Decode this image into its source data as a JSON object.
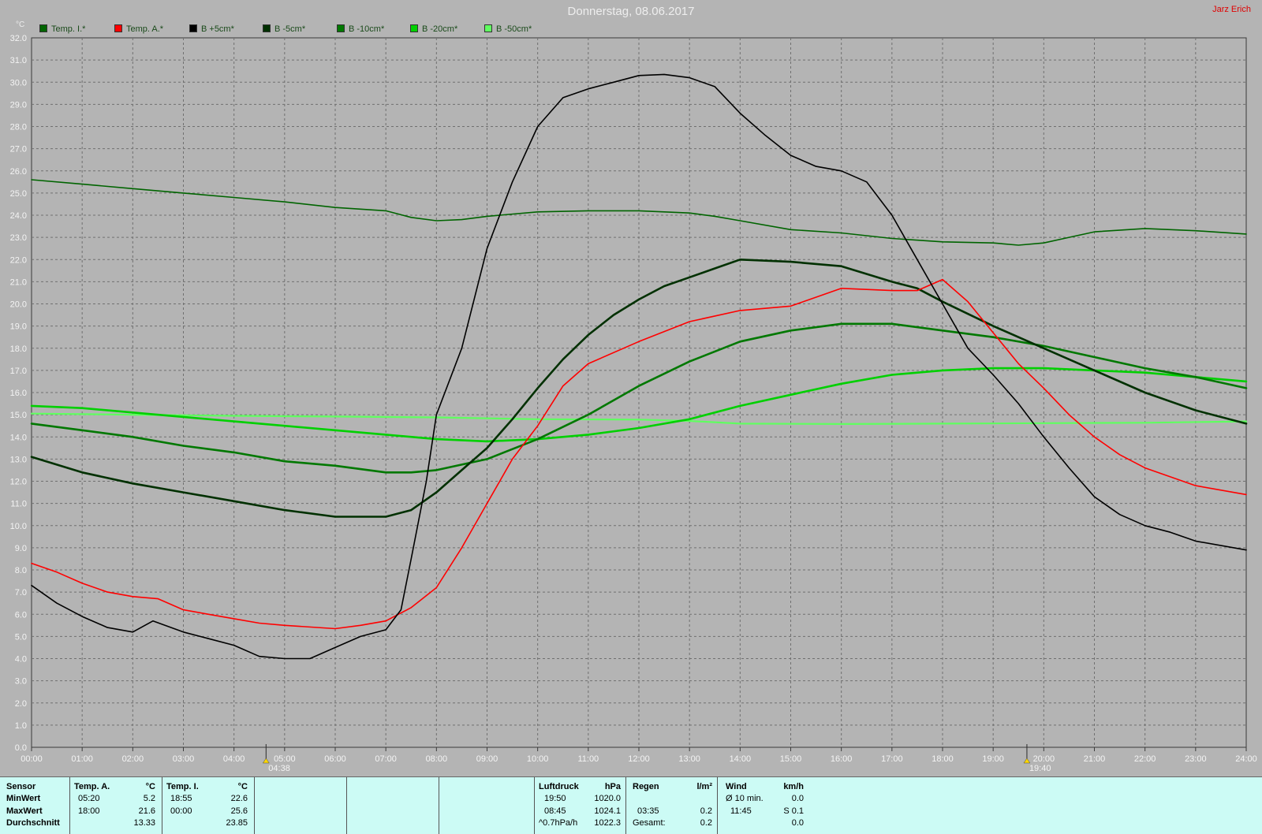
{
  "header": {
    "title": "Donnerstag, 08.06.2017",
    "author": "Jarz Erich",
    "unit": "°C"
  },
  "legend": [
    {
      "label": "Temp. I.*",
      "color": "#006400"
    },
    {
      "label": "Temp. A.*",
      "color": "#ff0000"
    },
    {
      "label": "B +5cm*",
      "color": "#000000"
    },
    {
      "label": "B -5cm*",
      "color": "#003000"
    },
    {
      "label": "B -10cm*",
      "color": "#007800"
    },
    {
      "label": "B -20cm*",
      "color": "#00d000"
    },
    {
      "label": "B -50cm*",
      "color": "#60ff60"
    }
  ],
  "sun_markers": {
    "sunrise": "04:38",
    "sunset": "19:40"
  },
  "chart_data": {
    "type": "line",
    "title": "Donnerstag, 08.06.2017",
    "ylabel": "°C",
    "xlabel": "",
    "xlim": [
      0,
      24
    ],
    "ylim": [
      0,
      32
    ],
    "grid": true,
    "legend_position": "top-left",
    "x_tick_labels": [
      "00:00",
      "01:00",
      "02:00",
      "03:00",
      "04:00",
      "05:00",
      "06:00",
      "07:00",
      "08:00",
      "09:00",
      "10:00",
      "11:00",
      "12:00",
      "13:00",
      "14:00",
      "15:00",
      "16:00",
      "17:00",
      "18:00",
      "19:00",
      "20:00",
      "21:00",
      "22:00",
      "23:00",
      "24:00"
    ],
    "y_tick_labels": [
      "0.0",
      "1.0",
      "2.0",
      "3.0",
      "4.0",
      "5.0",
      "6.0",
      "7.0",
      "8.0",
      "9.0",
      "10.0",
      "11.0",
      "12.0",
      "13.0",
      "14.0",
      "15.0",
      "16.0",
      "17.0",
      "18.0",
      "19.0",
      "20.0",
      "21.0",
      "22.0",
      "23.0",
      "24.0",
      "25.0",
      "26.0",
      "27.0",
      "28.0",
      "29.0",
      "30.0",
      "31.0",
      "32.0"
    ],
    "series": [
      {
        "name": "Temp. I.*",
        "color": "#006400",
        "width": 1.6,
        "points": [
          [
            0,
            25.6
          ],
          [
            1,
            25.4
          ],
          [
            2,
            25.2
          ],
          [
            3,
            25.0
          ],
          [
            4,
            24.8
          ],
          [
            5,
            24.6
          ],
          [
            6,
            24.35
          ],
          [
            7,
            24.2
          ],
          [
            7.5,
            23.9
          ],
          [
            8,
            23.75
          ],
          [
            8.5,
            23.8
          ],
          [
            9,
            23.95
          ],
          [
            10,
            24.15
          ],
          [
            11,
            24.2
          ],
          [
            12,
            24.2
          ],
          [
            13,
            24.1
          ],
          [
            13.5,
            23.95
          ],
          [
            14,
            23.75
          ],
          [
            15,
            23.35
          ],
          [
            16,
            23.2
          ],
          [
            17,
            22.95
          ],
          [
            18,
            22.8
          ],
          [
            19,
            22.75
          ],
          [
            19.5,
            22.65
          ],
          [
            20,
            22.75
          ],
          [
            20.5,
            23.0
          ],
          [
            21,
            23.25
          ],
          [
            22,
            23.4
          ],
          [
            23,
            23.3
          ],
          [
            24,
            23.15
          ]
        ]
      },
      {
        "name": "Temp. A.*",
        "color": "#ff0000",
        "width": 1.6,
        "points": [
          [
            0,
            8.3
          ],
          [
            0.5,
            7.9
          ],
          [
            1,
            7.4
          ],
          [
            1.5,
            7.0
          ],
          [
            2,
            6.8
          ],
          [
            2.5,
            6.7
          ],
          [
            3,
            6.2
          ],
          [
            3.5,
            6.0
          ],
          [
            4,
            5.8
          ],
          [
            4.5,
            5.6
          ],
          [
            5,
            5.5
          ],
          [
            6,
            5.35
          ],
          [
            6.5,
            5.5
          ],
          [
            7,
            5.7
          ],
          [
            7.5,
            6.3
          ],
          [
            8,
            7.2
          ],
          [
            8.5,
            9.0
          ],
          [
            9,
            11.0
          ],
          [
            9.5,
            13.0
          ],
          [
            10,
            14.5
          ],
          [
            10.5,
            16.3
          ],
          [
            11,
            17.3
          ],
          [
            12,
            18.3
          ],
          [
            13,
            19.2
          ],
          [
            14,
            19.7
          ],
          [
            15,
            19.9
          ],
          [
            16,
            20.7
          ],
          [
            17,
            20.6
          ],
          [
            17.5,
            20.6
          ],
          [
            18,
            21.1
          ],
          [
            18.5,
            20.1
          ],
          [
            19,
            18.7
          ],
          [
            19.5,
            17.3
          ],
          [
            20,
            16.2
          ],
          [
            20.5,
            15.0
          ],
          [
            21,
            14.0
          ],
          [
            21.5,
            13.2
          ],
          [
            22,
            12.6
          ],
          [
            22.5,
            12.2
          ],
          [
            23,
            11.8
          ],
          [
            24,
            11.4
          ]
        ]
      },
      {
        "name": "B +5cm*",
        "color": "#000000",
        "width": 1.6,
        "points": [
          [
            0,
            7.3
          ],
          [
            0.5,
            6.5
          ],
          [
            1,
            5.9
          ],
          [
            1.5,
            5.4
          ],
          [
            2,
            5.2
          ],
          [
            2.4,
            5.7
          ],
          [
            3,
            5.2
          ],
          [
            3.5,
            4.9
          ],
          [
            4,
            4.6
          ],
          [
            4.5,
            4.1
          ],
          [
            5,
            4.0
          ],
          [
            5.5,
            4.0
          ],
          [
            6,
            4.5
          ],
          [
            6.5,
            5.0
          ],
          [
            7,
            5.3
          ],
          [
            7.3,
            6.2
          ],
          [
            7.5,
            8.5
          ],
          [
            7.8,
            12.0
          ],
          [
            8,
            15.0
          ],
          [
            8.5,
            18.0
          ],
          [
            9,
            22.5
          ],
          [
            9.5,
            25.5
          ],
          [
            10,
            28.0
          ],
          [
            10.5,
            29.3
          ],
          [
            11,
            29.7
          ],
          [
            11.5,
            30.0
          ],
          [
            12,
            30.3
          ],
          [
            12.5,
            30.35
          ],
          [
            13,
            30.2
          ],
          [
            13.5,
            29.8
          ],
          [
            14,
            28.6
          ],
          [
            14.5,
            27.6
          ],
          [
            15,
            26.7
          ],
          [
            15.5,
            26.2
          ],
          [
            16,
            26.0
          ],
          [
            16.5,
            25.5
          ],
          [
            17,
            24.0
          ],
          [
            17.5,
            22.0
          ],
          [
            18,
            20.0
          ],
          [
            18.5,
            18.0
          ],
          [
            19,
            16.8
          ],
          [
            19.5,
            15.5
          ],
          [
            20,
            14.0
          ],
          [
            20.5,
            12.6
          ],
          [
            21,
            11.3
          ],
          [
            21.5,
            10.5
          ],
          [
            22,
            10.0
          ],
          [
            22.5,
            9.7
          ],
          [
            23,
            9.3
          ],
          [
            24,
            8.9
          ]
        ]
      },
      {
        "name": "B -5cm*",
        "color": "#003000",
        "width": 2.6,
        "points": [
          [
            0,
            13.1
          ],
          [
            1,
            12.4
          ],
          [
            2,
            11.9
          ],
          [
            3,
            11.5
          ],
          [
            4,
            11.1
          ],
          [
            5,
            10.7
          ],
          [
            6,
            10.4
          ],
          [
            7,
            10.4
          ],
          [
            7.5,
            10.7
          ],
          [
            8,
            11.5
          ],
          [
            8.5,
            12.5
          ],
          [
            9,
            13.5
          ],
          [
            9.5,
            14.8
          ],
          [
            10,
            16.2
          ],
          [
            10.5,
            17.5
          ],
          [
            11,
            18.6
          ],
          [
            11.5,
            19.5
          ],
          [
            12,
            20.2
          ],
          [
            12.5,
            20.8
          ],
          [
            13,
            21.2
          ],
          [
            13.5,
            21.6
          ],
          [
            14,
            22.0
          ],
          [
            15,
            21.9
          ],
          [
            16,
            21.7
          ],
          [
            17,
            21.0
          ],
          [
            17.5,
            20.7
          ],
          [
            18,
            20.1
          ],
          [
            19,
            19.0
          ],
          [
            20,
            18.0
          ],
          [
            21,
            17.0
          ],
          [
            22,
            16.0
          ],
          [
            23,
            15.2
          ],
          [
            24,
            14.6
          ]
        ]
      },
      {
        "name": "B -10cm*",
        "color": "#007800",
        "width": 2.6,
        "points": [
          [
            0,
            14.6
          ],
          [
            1,
            14.3
          ],
          [
            2,
            14.0
          ],
          [
            3,
            13.6
          ],
          [
            4,
            13.3
          ],
          [
            5,
            12.9
          ],
          [
            6,
            12.7
          ],
          [
            7,
            12.4
          ],
          [
            7.5,
            12.4
          ],
          [
            8,
            12.5
          ],
          [
            9,
            13.0
          ],
          [
            10,
            13.9
          ],
          [
            11,
            15.0
          ],
          [
            12,
            16.3
          ],
          [
            13,
            17.4
          ],
          [
            14,
            18.3
          ],
          [
            15,
            18.8
          ],
          [
            16,
            19.1
          ],
          [
            17,
            19.1
          ],
          [
            18,
            18.8
          ],
          [
            19,
            18.5
          ],
          [
            20,
            18.1
          ],
          [
            21,
            17.6
          ],
          [
            22,
            17.1
          ],
          [
            23,
            16.7
          ],
          [
            24,
            16.2
          ]
        ]
      },
      {
        "name": "B -20cm*",
        "color": "#00d000",
        "width": 2.6,
        "points": [
          [
            0,
            15.4
          ],
          [
            1,
            15.3
          ],
          [
            2,
            15.1
          ],
          [
            3,
            14.9
          ],
          [
            4,
            14.7
          ],
          [
            5,
            14.5
          ],
          [
            6,
            14.3
          ],
          [
            7,
            14.1
          ],
          [
            8,
            13.9
          ],
          [
            9,
            13.8
          ],
          [
            10,
            13.9
          ],
          [
            11,
            14.1
          ],
          [
            12,
            14.4
          ],
          [
            13,
            14.8
          ],
          [
            14,
            15.4
          ],
          [
            15,
            15.9
          ],
          [
            16,
            16.4
          ],
          [
            17,
            16.8
          ],
          [
            18,
            17.0
          ],
          [
            19,
            17.1
          ],
          [
            20,
            17.1
          ],
          [
            21,
            17.0
          ],
          [
            22,
            16.9
          ],
          [
            23,
            16.7
          ],
          [
            24,
            16.5
          ]
        ]
      },
      {
        "name": "B -50cm*",
        "color": "#60ff60",
        "width": 2.2,
        "points": [
          [
            0,
            15.05
          ],
          [
            2,
            15.0
          ],
          [
            4,
            14.95
          ],
          [
            6,
            14.92
          ],
          [
            8,
            14.88
          ],
          [
            10,
            14.8
          ],
          [
            12,
            14.78
          ],
          [
            13,
            14.72
          ],
          [
            14,
            14.6
          ],
          [
            16,
            14.58
          ],
          [
            18,
            14.6
          ],
          [
            20,
            14.62
          ],
          [
            22,
            14.64
          ],
          [
            24,
            14.7
          ]
        ]
      }
    ]
  },
  "stats": {
    "sensor": {
      "header": "Sensor",
      "min": "MinWert",
      "max": "MaxWert",
      "avg": "Durchschnitt"
    },
    "temp_a": {
      "header": "Temp. A.",
      "unit": "°C",
      "min_time": "05:20",
      "min_val": "5.2",
      "max_time": "18:00",
      "max_val": "21.6",
      "avg": "13.33"
    },
    "temp_i": {
      "header": "Temp. I.",
      "unit": "°C",
      "min_time": "18:55",
      "min_val": "22.6",
      "max_time": "00:00",
      "max_val": "25.6",
      "avg": "23.85"
    },
    "pressure": {
      "header": "Luftdruck",
      "unit": "hPa",
      "min_time": "19:50",
      "min_val": "1020.0",
      "max_time": "08:45",
      "max_val": "1024.1",
      "trend_label": "^0.7hPa/h",
      "trend_val": "1022.3"
    },
    "rain": {
      "header": "Regen",
      "unit": "l/m²",
      "max_time": "03:35",
      "max_val": "0.2",
      "total_label": "Gesamt:",
      "total_val": "0.2"
    },
    "wind": {
      "header": "Wind",
      "unit": "km/h",
      "avg_label": "Ø 10 min.",
      "avg_val": "0.0",
      "max_time": "11:45",
      "max_val": "S 0.1",
      "last_val": "0.0"
    }
  }
}
